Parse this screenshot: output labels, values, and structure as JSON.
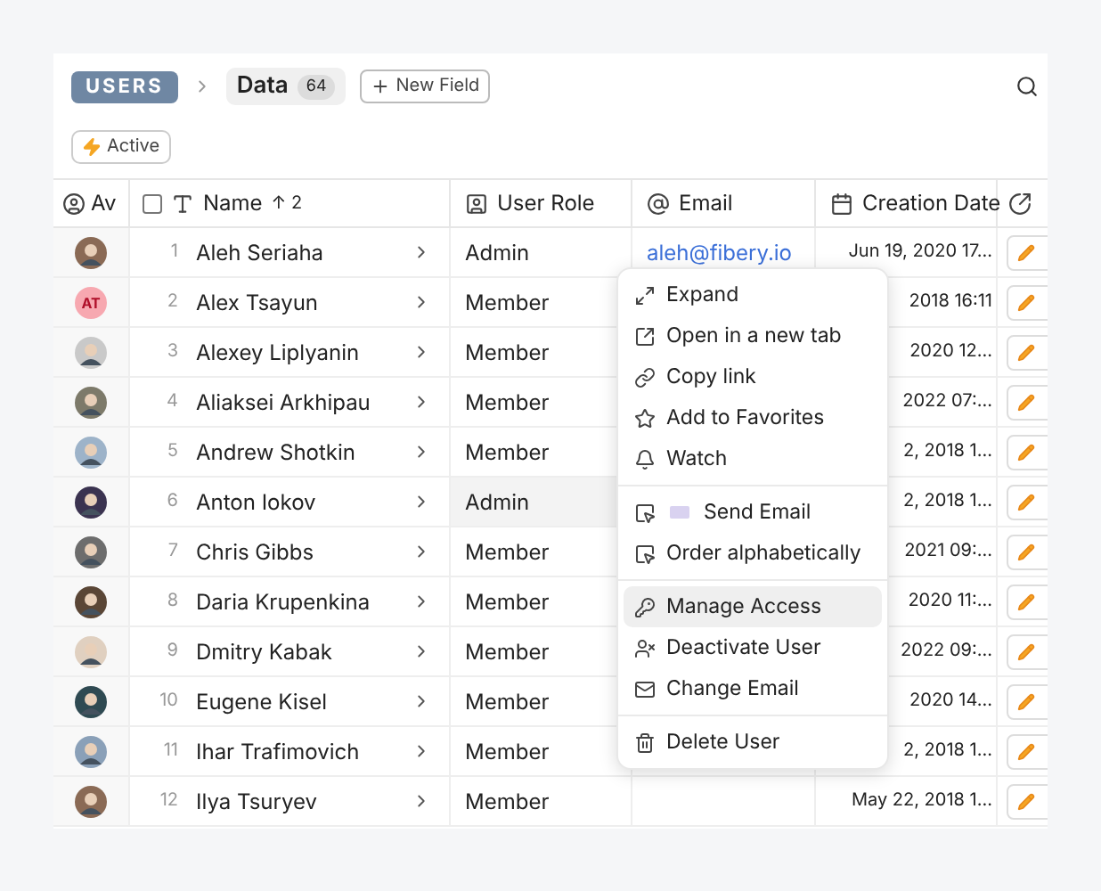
{
  "breadcrumb": {
    "database": "USERS",
    "view": "Data",
    "count": "64",
    "new_field": "New Field"
  },
  "filter": {
    "label": "Active"
  },
  "table": {
    "columns": [
      "Av",
      "Name",
      "User Role",
      "Email",
      "Creation Date"
    ],
    "select_all": {
      "checked": false
    },
    "sort": {
      "arrow": "↑",
      "count": "2"
    },
    "rows": [
      {
        "n": "1",
        "name": "Aleh Seriaha",
        "role": "Admin",
        "email": "aleh@fibery.io",
        "date": "Jun 19, 2020 17...",
        "avatar": {
          "kind": "photo"
        },
        "hovered": false
      },
      {
        "n": "2",
        "name": "Alex Tsayun",
        "role": "Member",
        "date": "2018 16:11",
        "avatar": {
          "kind": "initials",
          "text": "AT"
        },
        "hovered": false
      },
      {
        "n": "3",
        "name": "Alexey Liplyanin",
        "role": "Member",
        "date": "2020 12...",
        "avatar": {
          "kind": "photo"
        },
        "hovered": false
      },
      {
        "n": "4",
        "name": "Aliaksei Arkhipau",
        "role": "Member",
        "date": "2022 07:...",
        "avatar": {
          "kind": "photo"
        },
        "hovered": false
      },
      {
        "n": "5",
        "name": "Andrew Shotkin",
        "role": "Member",
        "date": "2, 2018 1...",
        "avatar": {
          "kind": "photo"
        },
        "hovered": false
      },
      {
        "n": "6",
        "name": "Anton Iokov",
        "role": "Admin",
        "date": "2, 2018 1...",
        "avatar": {
          "kind": "photo"
        },
        "hovered": true
      },
      {
        "n": "7",
        "name": "Chris Gibbs",
        "role": "Member",
        "date": "2021 09:...",
        "avatar": {
          "kind": "photo"
        },
        "hovered": false
      },
      {
        "n": "8",
        "name": "Daria Krupenkina",
        "role": "Member",
        "date": "2020 11:...",
        "avatar": {
          "kind": "photo"
        },
        "hovered": false
      },
      {
        "n": "9",
        "name": "Dmitry Kabak",
        "role": "Member",
        "date": "2022 09:...",
        "avatar": {
          "kind": "photo"
        },
        "hovered": false
      },
      {
        "n": "10",
        "name": "Eugene Kisel",
        "role": "Member",
        "date": "2020 14...",
        "avatar": {
          "kind": "photo"
        },
        "hovered": false
      },
      {
        "n": "11",
        "name": "Ihar Trafimovich",
        "role": "Member",
        "date": "2, 2018 1...",
        "avatar": {
          "kind": "photo"
        },
        "hovered": false
      },
      {
        "n": "12",
        "name": "Ilya Tsuryev",
        "role": "Member",
        "date": "May 22, 2018 1...",
        "avatar": {
          "kind": "photo"
        },
        "hovered": false
      }
    ]
  },
  "context_menu": {
    "groups": [
      [
        {
          "label": "Expand",
          "selected": false
        },
        {
          "label": "Open in a new tab",
          "selected": false
        },
        {
          "label": "Copy link",
          "selected": false
        },
        {
          "label": "Add to Favorites",
          "selected": false
        },
        {
          "label": "Watch",
          "selected": false
        }
      ],
      [
        {
          "label": "Send Email",
          "emoji": true,
          "selected": false
        },
        {
          "label": "Order alphabetically",
          "emoji": false,
          "selected": false
        }
      ],
      [
        {
          "label": "Manage Access",
          "selected": true
        },
        {
          "label": "Deactivate User",
          "selected": false
        },
        {
          "label": "Change Email",
          "selected": false
        }
      ],
      [
        {
          "label": "Delete User",
          "selected": false
        }
      ]
    ]
  }
}
